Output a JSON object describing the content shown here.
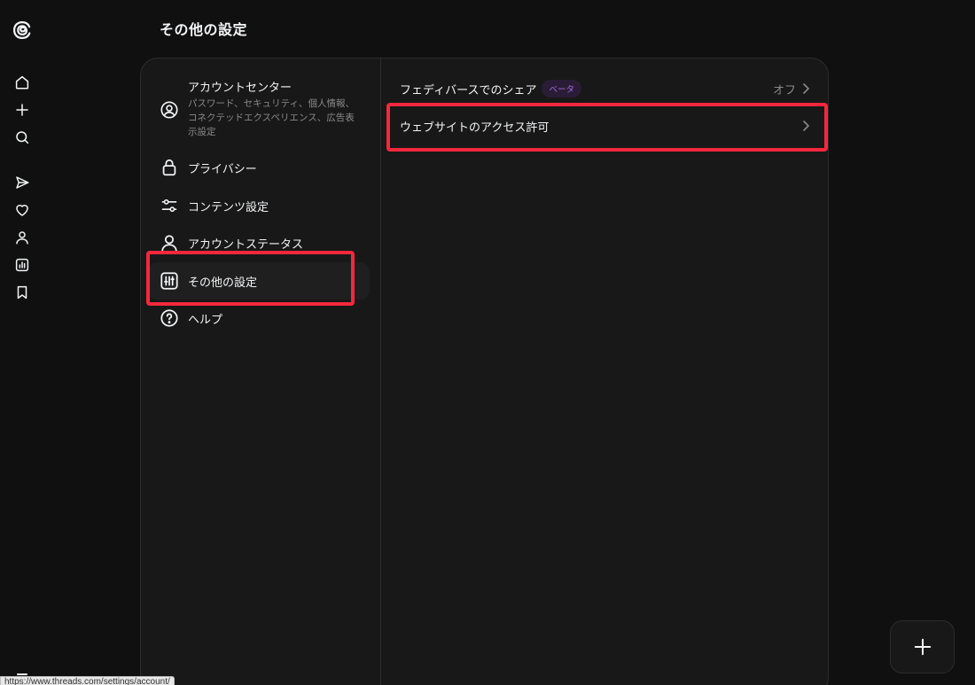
{
  "page": {
    "title": "その他の設定"
  },
  "rail": {
    "logo_icon": "threads-logo-icon",
    "items": [
      {
        "name": "home",
        "icon": "home-icon"
      },
      {
        "name": "create",
        "icon": "plus-icon"
      },
      {
        "name": "search",
        "icon": "search-icon"
      },
      {
        "name": "messages",
        "icon": "send-icon"
      },
      {
        "name": "activity",
        "icon": "heart-icon"
      },
      {
        "name": "profile",
        "icon": "person-icon"
      },
      {
        "name": "insights",
        "icon": "chart-icon"
      },
      {
        "name": "saved",
        "icon": "bookmark-icon"
      }
    ],
    "menu_icon": "menu-icon"
  },
  "settings_menu": {
    "items": [
      {
        "label": "アカウントセンター",
        "sub": "パスワード、セキュリティ、個人情報、コネクテッドエクスペリエンス、広告表示設定",
        "icon": "account-circle-icon"
      },
      {
        "label": "プライバシー",
        "icon": "lock-icon"
      },
      {
        "label": "コンテンツ設定",
        "icon": "sliders-icon"
      },
      {
        "label": "アカウントステータス",
        "icon": "person-icon"
      },
      {
        "label": "その他の設定",
        "icon": "settings-sliders-icon",
        "selected": true
      },
      {
        "label": "ヘルプ",
        "icon": "help-circle-icon"
      }
    ]
  },
  "content": {
    "rows": [
      {
        "label": "フェディバースでのシェア",
        "badge": "ベータ",
        "value": "オフ",
        "icon": "chevron-right-icon"
      },
      {
        "label": "ウェブサイトのアクセス許可",
        "value": "",
        "icon": "chevron-right-icon"
      }
    ]
  },
  "fab": {
    "icon": "plus-icon"
  },
  "status_bar": {
    "url": "https://www.threads.com/settings/account/"
  },
  "colors": {
    "background": "#101010",
    "card": "#181818",
    "text": "#f3f5f7",
    "muted": "#8a8a8a",
    "highlight": "#f4283d",
    "beta_badge_text": "#a56ad9",
    "beta_badge_bg": "#2a1c36"
  }
}
